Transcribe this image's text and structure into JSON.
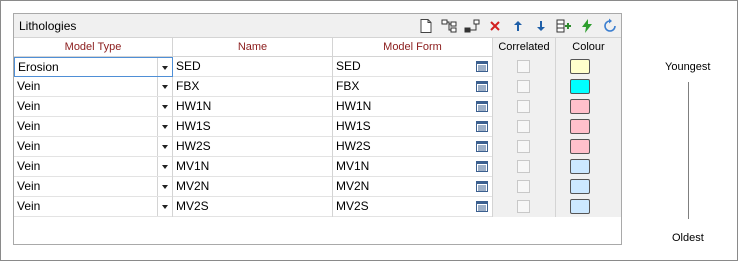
{
  "panel": {
    "title": "Lithologies"
  },
  "toolbar": {
    "buttons": [
      {
        "name": "new-icon",
        "tooltip": ""
      },
      {
        "name": "insert-icon",
        "tooltip": ""
      },
      {
        "name": "insert-after-icon",
        "tooltip": ""
      },
      {
        "name": "delete-icon",
        "tooltip": ""
      },
      {
        "name": "move-up-icon",
        "tooltip": ""
      },
      {
        "name": "move-down-icon",
        "tooltip": ""
      },
      {
        "name": "add-row-icon",
        "tooltip": ""
      },
      {
        "name": "lightning-icon",
        "tooltip": ""
      },
      {
        "name": "refresh-icon",
        "tooltip": ""
      }
    ]
  },
  "columns": {
    "model_type": "Model Type",
    "name": "Name",
    "model_form": "Model Form",
    "correlated": "Correlated",
    "colour": "Colour"
  },
  "rows": [
    {
      "model_type": "Erosion",
      "name": "SED",
      "model_form": "SED",
      "correlated": false,
      "colour": "#ffffcc"
    },
    {
      "model_type": "Vein",
      "name": "FBX",
      "model_form": "FBX",
      "correlated": false,
      "colour": "#00ffff"
    },
    {
      "model_type": "Vein",
      "name": "HW1N",
      "model_form": "HW1N",
      "correlated": false,
      "colour": "#ffc0cb"
    },
    {
      "model_type": "Vein",
      "name": "HW1S",
      "model_form": "HW1S",
      "correlated": false,
      "colour": "#ffc0cb"
    },
    {
      "model_type": "Vein",
      "name": "HW2S",
      "model_form": "HW2S",
      "correlated": false,
      "colour": "#ffc0cb"
    },
    {
      "model_type": "Vein",
      "name": "MV1N",
      "model_form": "MV1N",
      "correlated": false,
      "colour": "#cce8ff"
    },
    {
      "model_type": "Vein",
      "name": "MV2N",
      "model_form": "MV2N",
      "correlated": false,
      "colour": "#cce8ff"
    },
    {
      "model_type": "Vein",
      "name": "MV2S",
      "model_form": "MV2S",
      "correlated": false,
      "colour": "#cce8ff"
    }
  ],
  "legend": {
    "top": "Youngest",
    "bottom": "Oldest"
  }
}
